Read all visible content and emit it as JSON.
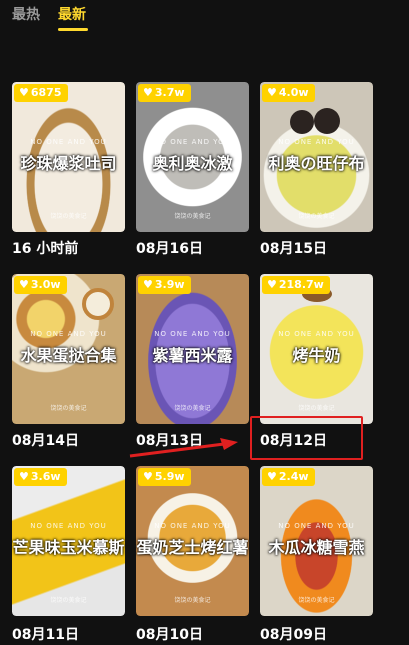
{
  "tabs": [
    {
      "label": "最热",
      "active": false
    },
    {
      "label": "最新",
      "active": true
    }
  ],
  "videos": [
    {
      "likes": "6875",
      "title": "珍珠爆浆吐司",
      "date": "16 小时前",
      "watermark": "NO ONE AND YOU",
      "signature": "饶饶の美食记"
    },
    {
      "likes": "3.7w",
      "title": "奥利奥冰激",
      "date": "08月16日",
      "watermark": "NO ONE AND YOU",
      "signature": "饶饶の美食记"
    },
    {
      "likes": "4.0w",
      "title": "利奥の旺仔布",
      "date": "08月15日",
      "watermark": "NO ONE AND YOU",
      "signature": "饶饶の美食记"
    },
    {
      "likes": "3.0w",
      "title": "水果蛋挞合集",
      "date": "08月14日",
      "watermark": "NO ONE AND YOU",
      "signature": "饶饶の美食记"
    },
    {
      "likes": "3.9w",
      "title": "紫薯西米露",
      "date": "08月13日",
      "watermark": "NO ONE AND YOU",
      "signature": "饶饶の美食记"
    },
    {
      "likes": "218.7w",
      "title": "烤牛奶",
      "date": "08月12日",
      "watermark": "NO ONE AND YOU",
      "signature": "饶饶の美食记"
    },
    {
      "likes": "3.6w",
      "title": "芒果味玉米慕斯",
      "date": "08月11日",
      "watermark": "NO ONE AND YOU",
      "signature": "饶饶の美食记"
    },
    {
      "likes": "5.9w",
      "title": "蛋奶芝士烤红薯",
      "date": "08月10日",
      "watermark": "NO ONE AND YOU",
      "signature": "饶饶の美食记"
    },
    {
      "likes": "2.4w",
      "title": "木瓜冰糖雪燕",
      "date": "08月09日",
      "watermark": "NO ONE AND YOU",
      "signature": "饶饶の美食记"
    }
  ],
  "icons": {
    "likes": "heart-icon"
  },
  "colors": {
    "accent": "#ffd92e",
    "badge": "#ffd200",
    "annotation": "#e02020",
    "background": "#111111"
  }
}
